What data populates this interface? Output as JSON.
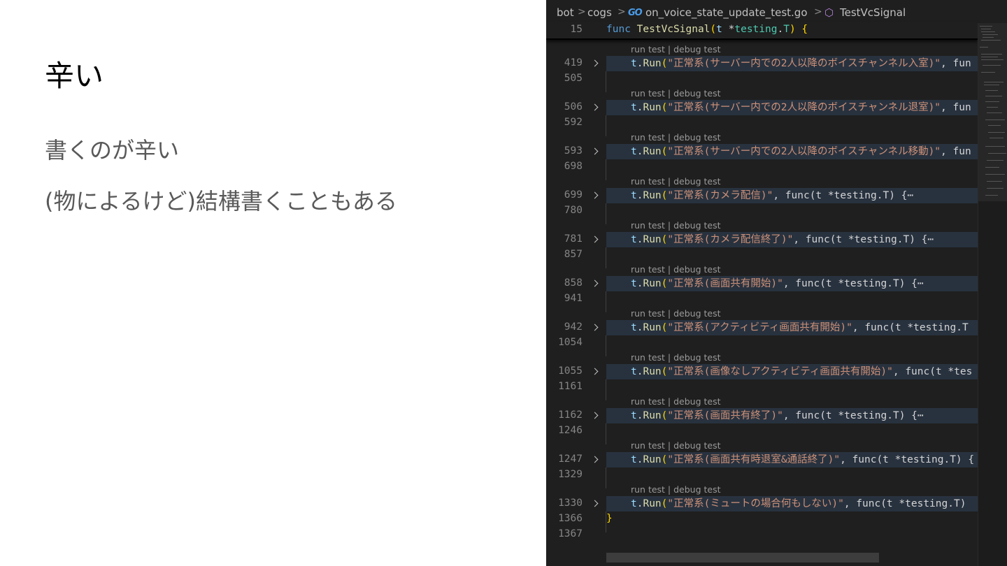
{
  "slide": {
    "title": "辛い",
    "bullets": [
      "書くのが辛い",
      "(物によるけど)結構書くこともある"
    ]
  },
  "editor": {
    "breadcrumb": {
      "items": [
        "bot",
        "cogs",
        "on_voice_state_update_test.go",
        "TestVcSignal"
      ],
      "separator": ">",
      "file_icon": "go-file-icon",
      "file_icon_glyph": "GO",
      "symbol_icon": "method-cube-icon",
      "symbol_icon_glyph": "⬡"
    },
    "sticky": {
      "line_number": "15",
      "keyword": "func",
      "name": "TestVcSignal",
      "params_open": "(",
      "param_name": "t",
      "param_ptr": " *",
      "param_pkg": "testing",
      "param_dot": ".",
      "param_type": "T",
      "params_close": ")",
      "brace": "{"
    },
    "codelens": "run test | debug test",
    "test_blocks": [
      {
        "start": "419",
        "end": "505",
        "name": "\"正常系(サーバー内での2人以降のボイスチャンネル入室)\"",
        "tail": ", fun"
      },
      {
        "start": "506",
        "end": "592",
        "name": "\"正常系(サーバー内での2人以降のボイスチャンネル退室)\"",
        "tail": ", fun"
      },
      {
        "start": "593",
        "end": "698",
        "name": "\"正常系(サーバー内での2人以降のボイスチャンネル移動)\"",
        "tail": ", fun"
      },
      {
        "start": "699",
        "end": "780",
        "name": "\"正常系(カメラ配信)\"",
        "tail": ", func(t *testing.T) {⋯"
      },
      {
        "start": "781",
        "end": "857",
        "name": "\"正常系(カメラ配信終了)\"",
        "tail": ", func(t *testing.T) {⋯"
      },
      {
        "start": "858",
        "end": "941",
        "name": "\"正常系(画面共有開始)\"",
        "tail": ", func(t *testing.T) {⋯"
      },
      {
        "start": "942",
        "end": "1054",
        "name": "\"正常系(アクティビティ画面共有開始)\"",
        "tail": ", func(t *testing.T"
      },
      {
        "start": "1055",
        "end": "1161",
        "name": "\"正常系(画像なしアクティビティ画面共有開始)\"",
        "tail": ", func(t *tes"
      },
      {
        "start": "1162",
        "end": "1246",
        "name": "\"正常系(画面共有終了)\"",
        "tail": ", func(t *testing.T) {⋯"
      },
      {
        "start": "1247",
        "end": "1329",
        "name": "\"正常系(画面共有時退室&通話終了)\"",
        "tail": ", func(t *testing.T) {"
      },
      {
        "start": "1330",
        "end": "1366",
        "name": "\"正常系(ミュートの場合何もしない)\"",
        "tail": ", func(t *testing.T)"
      }
    ],
    "call_receiver": "t",
    "call_method": "Run",
    "call_open": "(",
    "closing_brace": "}",
    "closing_brace_line": "1366",
    "last_line": "1367"
  },
  "colors": {
    "editor_bg": "#1f1f1f",
    "fold_highlight": "#28323f",
    "string": "#ce9178",
    "keyword": "#569cd6",
    "function": "#dcdcaa",
    "variable": "#9cdcfe",
    "type": "#4ec9b0",
    "brace": "#ffd700"
  }
}
